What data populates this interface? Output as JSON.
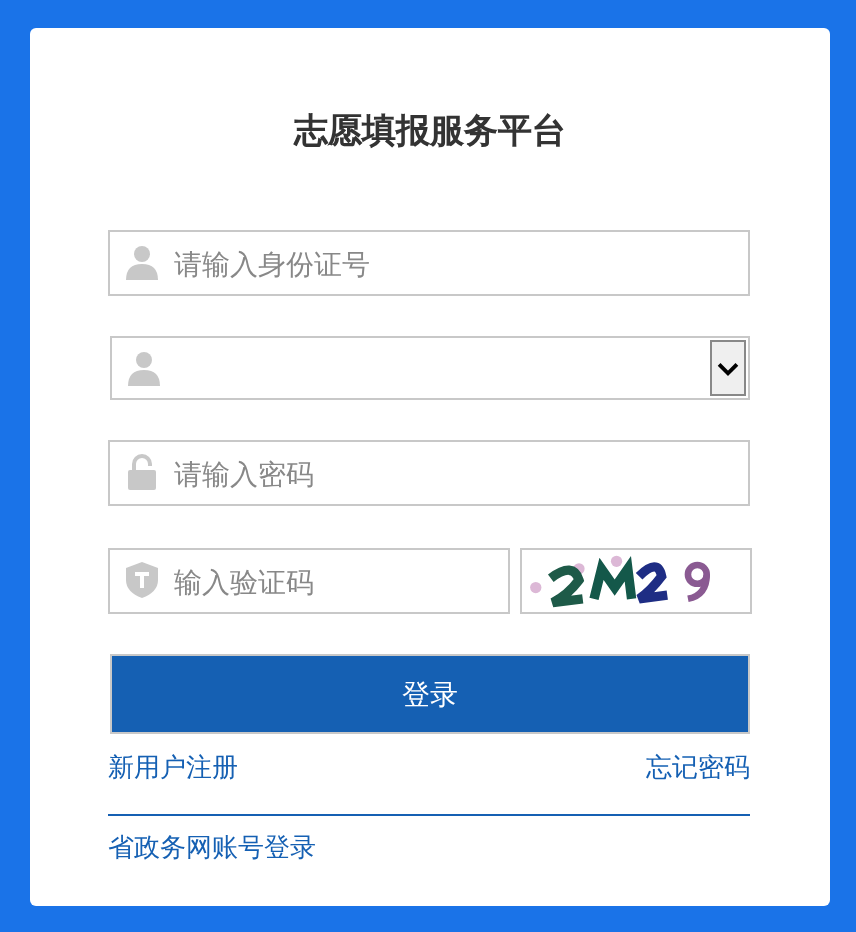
{
  "title": "志愿填报服务平台",
  "id_field": {
    "placeholder": "请输入身份证号"
  },
  "password_field": {
    "placeholder": "请输入密码"
  },
  "captcha_field": {
    "placeholder": "输入验证码"
  },
  "login_button": "登录",
  "register_link": "新用户注册",
  "forgot_link": "忘记密码",
  "gov_login_link": "省政务网账号登录"
}
